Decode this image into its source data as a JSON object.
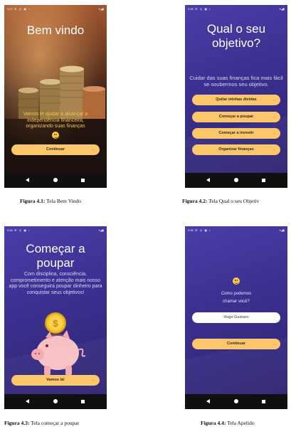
{
  "phones": {
    "welcome": {
      "status_time": "9:47",
      "title": "Bem vindo",
      "message": "Vamos te ajudar a alcançar a independência financeira, organizando suas finanças",
      "button": "Continuar",
      "caption_label": "Figura 4.1:",
      "caption_text": "Tela Bem Vindo"
    },
    "objective": {
      "status_time": "9:58",
      "title": "Qual o seu objetivo?",
      "message": "Cuidar das suas finanças fica mais fácil se soubermos seu objetivo.",
      "options": [
        "Quitar minhas dívidas",
        "Começar a poupar",
        "Começar a investir",
        "Organizar finanças"
      ],
      "caption_label": "Figura 4.2:",
      "caption_text": "Tela Qual o seu Objetiv"
    },
    "save": {
      "status_time": "9:58",
      "title": "Começar a poupar",
      "message": "Com disciplina, consciência, comprometimento e atenção mais nosso app você conseguira poupar dinheiro para conquistar seus objetivos!",
      "button": "Vamos lá!",
      "caption_label": "Figura 4.3:",
      "caption_text": "Tela começar a poupar"
    },
    "nickname": {
      "status_time": "9:58",
      "question": "Como podemos chamar você?",
      "name_value": "Hugo Gustavo",
      "button": "Continuar",
      "caption_label": "Figura 4.4:",
      "caption_text": "Tela Apelido"
    }
  },
  "colors": {
    "purple_bg": "#3b3090",
    "button": "#fcc66a",
    "navbar": "#101010"
  }
}
